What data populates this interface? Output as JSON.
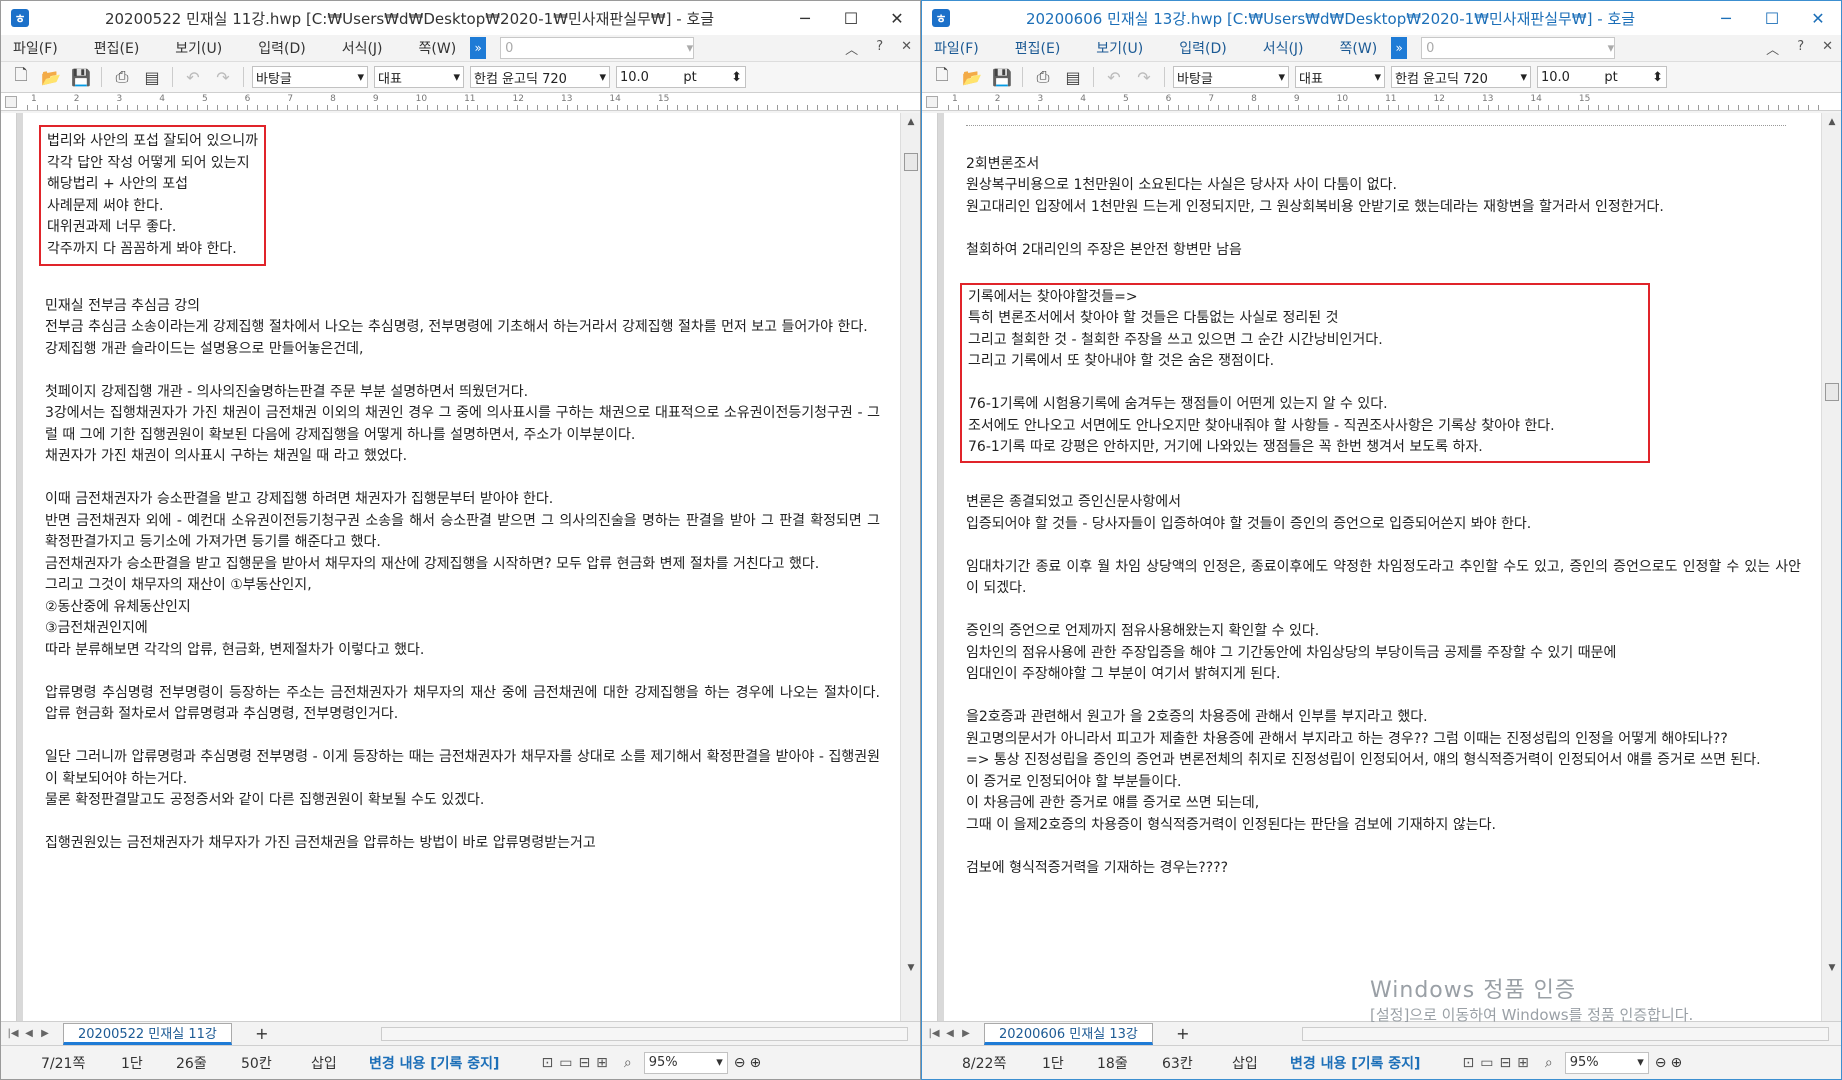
{
  "left": {
    "title": "20200522 민재실 11강.hwp [C:₩Users₩d₩Desktop₩2020-1₩민사재판실무₩] - 호글",
    "menus": [
      "파일(F)",
      "편집(E)",
      "보기(U)",
      "입력(D)",
      "서식(J)",
      "쪽(W)"
    ],
    "menu_combo": "0",
    "style_combo": "바탕글",
    "lang_combo": "대표",
    "font_combo": "한컴 윤고딕 720",
    "size_combo": "10.0",
    "size_unit": "pt",
    "ruler_nums": [
      "1",
      "2",
      "3",
      "4",
      "5",
      "6",
      "7",
      "8",
      "9",
      "10",
      "11",
      "12",
      "13",
      "14",
      "15"
    ],
    "boxed_lines": [
      "법리와 사안의 포섭 잘되어 있으니까",
      "각각 답안 작성 어떻게 되어 있는지",
      "해당법리 + 사안의 포섭",
      "사례문제 써야 한다.",
      "대위권과제 너무 좋다.",
      "각주까지 다 꼼꼼하게 봐야 한다."
    ],
    "lines": [
      "",
      "민재실 전부금 추심금 강의",
      "전부금 추심금 소송이라는게 강제집행 절차에서 나오는 추심명령, 전부명령에 기초해서 하는거라서 강제집행 절차를 먼저 보고 들어가야 한다.",
      "강제집행 개관 슬라이드는 설명용으로 만들어놓은건데,",
      "",
      "첫페이지 강제집행 개관 - 의사의진술명하는판결 주문 부분 설명하면서 띄웠던거다.",
      "3강에서는 집행채권자가 가진 채권이 금전채권 이외의 채권인 경우 그 중에 의사표시를 구하는 채권으로 대표적으로 소유권이전등기청구권 - 그럴 때 그에 기한 집행권원이 확보된 다음에 강제집행을 어떻게 하나를 설명하면서, 주소가 이부분이다.",
      "채권자가 가진 채권이 의사표시 구하는 채권일 때 라고 했었다.",
      "",
      "이때 금전채권자가 승소판결을 받고 강제집행 하려면 채권자가 집행문부터 받아야 한다.",
      "반면 금전채권자 외에 - 예컨대 소유권이전등기청구권 소송을 해서 승소판결 받으면 그 의사의진술을 명하는 판결을 받아 그 판결 확정되면 그 확정판결가지고 등기소에 가져가면 등기를 해준다고 했다.",
      "금전채권자가 승소판결을 받고 집행문을 받아서 채무자의 재산에 강제집행을 시작하면? 모두 압류 현금화 변제 절차를 거친다고 했다.",
      "그리고 그것이 채무자의 재산이 ①부동산인지,",
      "②동산중에 유체동산인지",
      "③금전채권인지에",
      "따라 분류해보면 각각의 압류, 현금화, 변제절차가 이렇다고 했다.",
      "",
      "압류명령 추심명령 전부명령이 등장하는 주소는 금전채권자가 채무자의 재산 중에 금전채권에 대한 강제집행을 하는 경우에 나오는 절차이다. 압류 현금화 절차로서 압류명령과 추심명령, 전부명령인거다.",
      "",
      "일단 그러니까 압류명령과 추심명령 전부명령 - 이게 등장하는 때는 금전채권자가 채무자를 상대로 소를 제기해서 확정판결을 받아야 - 집행권원이 확보되어야 하는거다.",
      "물론 확정판결말고도 공정증서와 같이 다른 집행권원이 확보될 수도 있겠다.",
      "",
      "집행권원있는 금전채권자가 채무자가 가진 금전채권을 압류하는 방법이 바로 압류명령받는거고"
    ],
    "tab": "20200522 민재실 11강",
    "status": {
      "page": "7/21쪽",
      "column": "1단",
      "line": "26줄",
      "col": "50칸",
      "mode": "삽입",
      "track": "변경 내용 [기록 중지]",
      "zoom": "95%"
    }
  },
  "right": {
    "title": "20200606 민재실 13강.hwp [C:₩Users₩d₩Desktop₩2020-1₩민사재판실무₩] - 호글",
    "menus": [
      "파일(F)",
      "편집(E)",
      "보기(U)",
      "입력(D)",
      "서식(J)",
      "쪽(W)"
    ],
    "menu_combo": "0",
    "style_combo": "바탕글",
    "lang_combo": "대표",
    "font_combo": "한컴 윤고딕 720",
    "size_combo": "10.0",
    "size_unit": "pt",
    "ruler_nums": [
      "1",
      "2",
      "3",
      "4",
      "5",
      "6",
      "7",
      "8",
      "9",
      "10",
      "11",
      "12",
      "13",
      "14",
      "15"
    ],
    "lines_top": [
      "",
      "2회변론조서",
      "원상복구비용으로 1천만원이 소요된다는 사실은 당사자 사이 다툼이 없다.",
      "원고대리인 입장에서 1천만원 드는게 인정되지만, 그 원상회복비용 안받기로 했는데라는 재항변을 할거라서 인정한거다.",
      "",
      "철회하여 2대리인의 주장은 본안전 항변만 남음",
      ""
    ],
    "boxed_lines": [
      "기록에서는 찾아야할것들=>",
      "특히 변론조서에서 찾아야 할 것들은 다툼없는 사실로 정리된 것",
      "그리고 철회한 것 - 철회한 주장을 쓰고 있으면 그 순간 시간낭비인거다.",
      "그리고 기록에서 또 찾아내야 할 것은 숨은 쟁점이다.",
      "",
      "76-1기록에 시험용기록에 숨겨두는 쟁점들이 어떤게 있는지 알 수 있다.",
      "조서에도 안나오고 서면에도 안나오지만 찾아내줘야 할 사항들 - 직권조사사항은 기록상 찾아야 한다.",
      "76-1기록 따로 강평은 안하지만, 거기에 나와있는 쟁점들은 꼭 한번 챙겨서 보도록 하자."
    ],
    "lines_bottom": [
      "",
      "변론은 종결되었고 증인신문사항에서",
      "입증되어야 할 것들 - 당사자들이 입증하여야 할 것들이 증인의 증언으로 입증되어쓴지 봐야 한다.",
      "",
      "임대차기간 종료 이후 월 차임 상당액의 인정은, 종료이후에도 약정한 차임정도라고 추인할 수도 있고, 증인의 증언으로도 인정할 수 있는 사안이 되겠다.",
      "",
      "증인의 증언으로 언제까지 점유사용해왔는지 확인할 수 있다.",
      "임차인의 점유사용에 관한 주장입증을 해야 그 기간동안에 차임상당의 부당이득금 공제를 주장할 수 있기 때문에",
      "임대인이 주장해야할 그 부분이 여기서 밝혀지게 된다.",
      "",
      "을2호증과 관련해서 원고가 을 2호증의 차용증에 관해서 인부를 부지라고 했다.",
      "원고명의문서가 아니라서 피고가 제출한 차용증에 관해서 부지라고 하는 경우?? 그럼 이때는 진정성립의 인정을 어떻게 해야되나??",
      "=> 통상 진정성립을 증인의 증언과 변론전체의 취지로 진정성립이 인정되어서, 얘의 형식적증거력이 인정되어서 얘를 증거로 쓰면 된다.",
      "이 증거로 인정되어야 할 부분들이다.",
      "이 차용금에 관한 증거로 얘를 증거로 쓰면 되는데,",
      "그때 이 을제2호증의 차용증이 형식적증거력이 인정된다는 판단을 검보에 기재하지 않는다.",
      "",
      "검보에 형식적증거력을 기재하는 경우는????"
    ],
    "tab": "20200606 민재실 13강",
    "status": {
      "page": "8/22쪽",
      "column": "1단",
      "line": "18줄",
      "col": "63칸",
      "mode": "삽입",
      "track": "변경 내용 [기록 중지]",
      "zoom": "95%"
    }
  },
  "watermark": {
    "line1": "Windows 정품 인증",
    "line2": "[설정]으로 이동하여 Windows를 정품 인증합니다."
  },
  "icons": {
    "app": "hwp-app-icon",
    "minimize": "minimize-icon",
    "maximize": "maximize-icon",
    "close": "close-icon",
    "new": "new-document-icon",
    "open": "open-folder-icon",
    "save": "save-icon",
    "print": "print-icon",
    "undo": "undo-icon",
    "redo": "redo-icon",
    "zoom": "magnifier-icon"
  },
  "colors": {
    "accent": "#1e7bd6",
    "highlight_box": "#e0242a",
    "status_blue": "#1c6fb8"
  }
}
